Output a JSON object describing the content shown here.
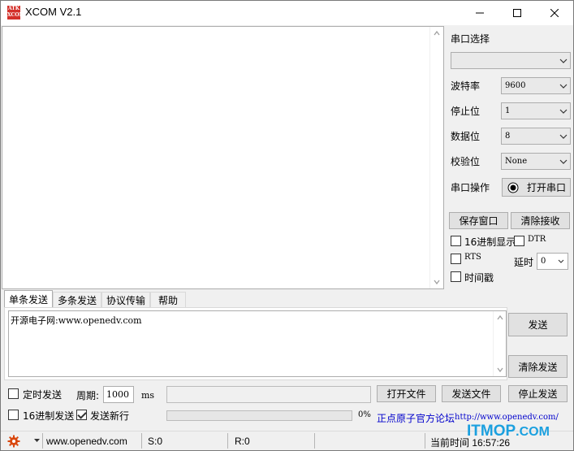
{
  "window": {
    "title": "XCOM V2.1",
    "logo_top": "ATK",
    "logo_bottom": "XCOM"
  },
  "right_panel": {
    "port_select_label": "串口选择",
    "port_value": "",
    "baud_label": "波特率",
    "baud_value": "9600",
    "stop_label": "停止位",
    "stop_value": "1",
    "data_label": "数据位",
    "data_value": "8",
    "parity_label": "校验位",
    "parity_value": "None",
    "port_op_label": "串口操作",
    "open_port_label": "打开串口",
    "save_window_label": "保存窗口",
    "clear_recv_label": "清除接收",
    "hex_display_label": "16进制显示",
    "dtr_label": "DTR",
    "rts_label": "RTS",
    "delay_label": "延时",
    "delay_value": "0",
    "timestamp_label": "时间戳"
  },
  "tabs": [
    "单条发送",
    "多条发送",
    "协议传输",
    "帮助"
  ],
  "send": {
    "text": "开源电子网:www.openedv.com",
    "send_label": "发送",
    "clear_send_label": "清除发送",
    "timed_send_label": "定时发送",
    "period_label": "周期:",
    "period_value": "1000",
    "ms_label": "ms",
    "open_file_label": "打开文件",
    "send_file_label": "发送文件",
    "stop_send_label": "停止发送",
    "hex_send_label": "16进制发送",
    "send_newline_label": "发送新行",
    "progress_text": "0%",
    "forum_link": "正点原子官方论坛",
    "forum_url_text": "http://www.openedv.com/"
  },
  "status": {
    "site": "www.openedv.com",
    "sent": "S:0",
    "received": "R:0",
    "time": "当前时间 16:57:26"
  },
  "watermark": {
    "main": "ITMOP",
    "suffix": ".COM"
  },
  "colors": {
    "logo": "#d4302a",
    "link": "#0000cc",
    "watermark": "#1ba0df",
    "gear": "#d9480f"
  }
}
